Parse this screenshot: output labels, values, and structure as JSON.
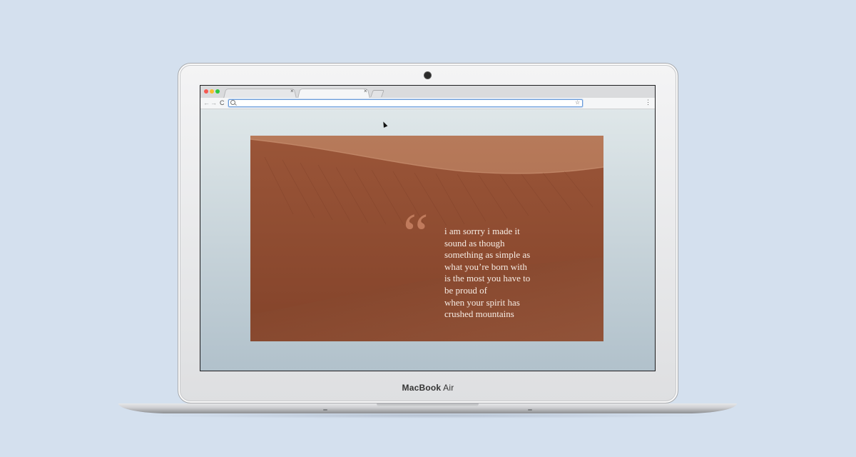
{
  "device": {
    "brand_bold": "MacBook",
    "brand_light": "Air"
  },
  "browser": {
    "tabs": [
      {
        "label": "",
        "close": "×"
      },
      {
        "label": "",
        "close": "×"
      }
    ],
    "toolbar": {
      "back": "←",
      "forward": "→",
      "reload": "C",
      "url_value": "",
      "bookmark": "☆",
      "menu": "⋮"
    }
  },
  "page": {
    "quote_mark": "“",
    "quote_lines": [
      "i am sorrry i made it",
      "sound as though",
      "something as simple as",
      "what you’re born with",
      "is the most you have to",
      "be proud of",
      "when your spirit has",
      "crushed mountains"
    ]
  },
  "colors": {
    "background": "#d4e0ee",
    "desert": "#9b5a3d",
    "quote_text": "#f6ece4"
  },
  "icons": [
    "search-icon",
    "star-icon",
    "menu-icon",
    "reload-icon",
    "back-arrow-icon",
    "forward-arrow-icon",
    "close-icon",
    "mouse-cursor-icon",
    "camera-icon"
  ]
}
